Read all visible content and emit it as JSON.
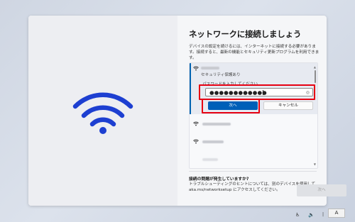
{
  "setup": {
    "title": "ネットワークに接続しましょう",
    "description": "デバイスの設定を続けるには、インターネットに接続する必要があります。接続すると、最新の機能とセキュリティ更新プログラムを利用できます。"
  },
  "network_list": {
    "selected": {
      "security": "セキュリティ保護あり",
      "password_label": "パスワードを入力してください",
      "password_value": "●●●●●●●●●●●●",
      "next_label": "次へ",
      "cancel_label": "キャンセル"
    }
  },
  "help": {
    "title": "接続の問題が発生していますか?",
    "text": "トラブルシューティングのヒントについては、別のデバイスを使用して、aka.ms/networksetup にアクセスしてください。"
  },
  "footer": {
    "next_label": "次へ"
  },
  "taskbar": {
    "ime_label": "A"
  },
  "colors": {
    "accent": "#005fb8",
    "highlight": "#e60012",
    "wifi_hero": "#1d3fd1"
  },
  "icons": [
    "wifi-hero-icon",
    "wifi-icon",
    "eye-icon",
    "accessibility-icon",
    "volume-icon"
  ]
}
